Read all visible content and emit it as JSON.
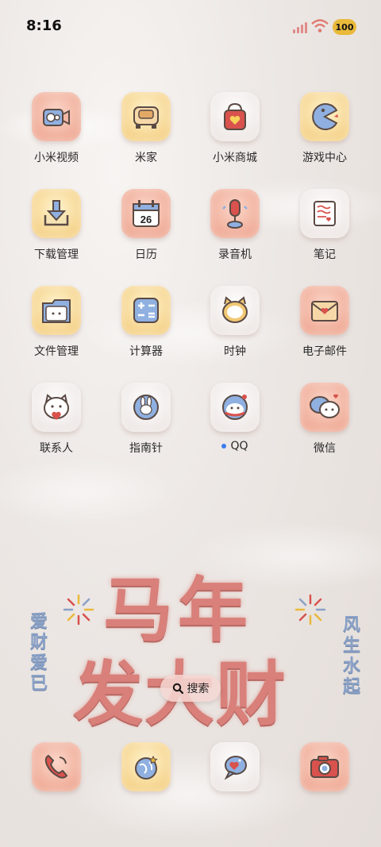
{
  "status_bar": {
    "time": "8:16",
    "battery": "100"
  },
  "apps": [
    {
      "label": "小米视频",
      "icon": "video-camera-icon",
      "tile": "peach"
    },
    {
      "label": "米家",
      "icon": "toaster-icon",
      "tile": "yellow"
    },
    {
      "label": "小米商城",
      "icon": "shopping-bag-icon",
      "tile": "white"
    },
    {
      "label": "游戏中心",
      "icon": "pacman-icon",
      "tile": "yellow"
    },
    {
      "label": "下载管理",
      "icon": "download-icon",
      "tile": "yellow"
    },
    {
      "label": "日历",
      "icon": "calendar-icon",
      "tile": "peach",
      "day": "26"
    },
    {
      "label": "录音机",
      "icon": "microphone-icon",
      "tile": "peach"
    },
    {
      "label": "笔记",
      "icon": "note-icon",
      "tile": "white"
    },
    {
      "label": "文件管理",
      "icon": "folder-icon",
      "tile": "yellow"
    },
    {
      "label": "计算器",
      "icon": "calculator-icon",
      "tile": "yellow"
    },
    {
      "label": "时钟",
      "icon": "clock-icon",
      "tile": "white"
    },
    {
      "label": "电子邮件",
      "icon": "mail-icon",
      "tile": "peach"
    },
    {
      "label": "联系人",
      "icon": "contacts-cat-icon",
      "tile": "white"
    },
    {
      "label": "指南针",
      "icon": "compass-bunny-icon",
      "tile": "white"
    },
    {
      "label": "QQ",
      "icon": "qq-penguin-icon",
      "tile": "white",
      "new_dot": true
    },
    {
      "label": "微信",
      "icon": "wechat-icon",
      "tile": "peach"
    }
  ],
  "wallpaper": {
    "line1": "马年",
    "line2": "发大财",
    "left_vertical": "爱财爱已",
    "right_vertical": "风生水起"
  },
  "search": {
    "label": "搜索"
  },
  "dock": [
    {
      "icon": "phone-icon",
      "tile": "peach"
    },
    {
      "icon": "browser-globe-icon",
      "tile": "yellow"
    },
    {
      "icon": "messages-icon",
      "tile": "white"
    },
    {
      "icon": "camera-icon",
      "tile": "peach"
    }
  ],
  "colors": {
    "peach": "#ec9d86",
    "yellow": "#f2c873",
    "accent_red": "#d9524d",
    "accent_blue": "#8aa1c6"
  }
}
